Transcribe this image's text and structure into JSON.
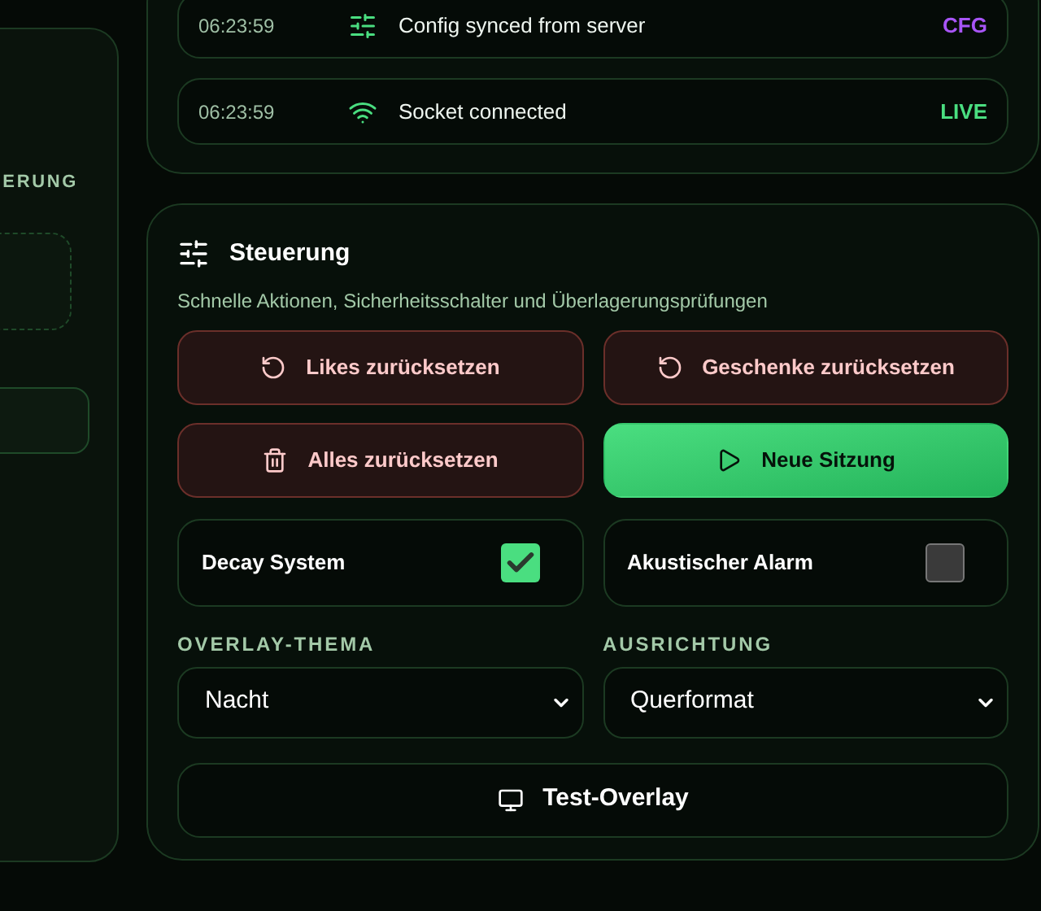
{
  "left_panel": {
    "section_label": "ERUNG"
  },
  "log": [
    {
      "time": "06:23:59",
      "kind": "config",
      "message": "Config synced from server",
      "tag": "CFG",
      "color": "#a855f7"
    },
    {
      "time": "06:23:59",
      "kind": "socket",
      "message": "Socket connected",
      "tag": "LIVE",
      "color": "#4ade80"
    }
  ],
  "controls": {
    "title": "Steuerung",
    "subtitle": "Schnelle Aktionen, Sicherheitsschalter und Überlagerungsprüfungen",
    "actions": [
      {
        "label": "Likes zurücksetzen",
        "kind": "reset"
      },
      {
        "label": "Geschenke zurücksetzen",
        "kind": "reset"
      },
      {
        "label": "Alles zurücksetzen",
        "kind": "clear"
      },
      {
        "label": "Neue Sitzung",
        "kind": "start"
      }
    ],
    "toggles": [
      {
        "label": "Decay System",
        "checked": true
      },
      {
        "label": "Akustischer Alarm",
        "checked": false
      }
    ],
    "selects": [
      {
        "label": "OVERLAY-THEMA",
        "value": "Nacht"
      },
      {
        "label": "AUSRICHTUNG",
        "value": "Querformat"
      }
    ],
    "test_button": "Test-Overlay"
  }
}
